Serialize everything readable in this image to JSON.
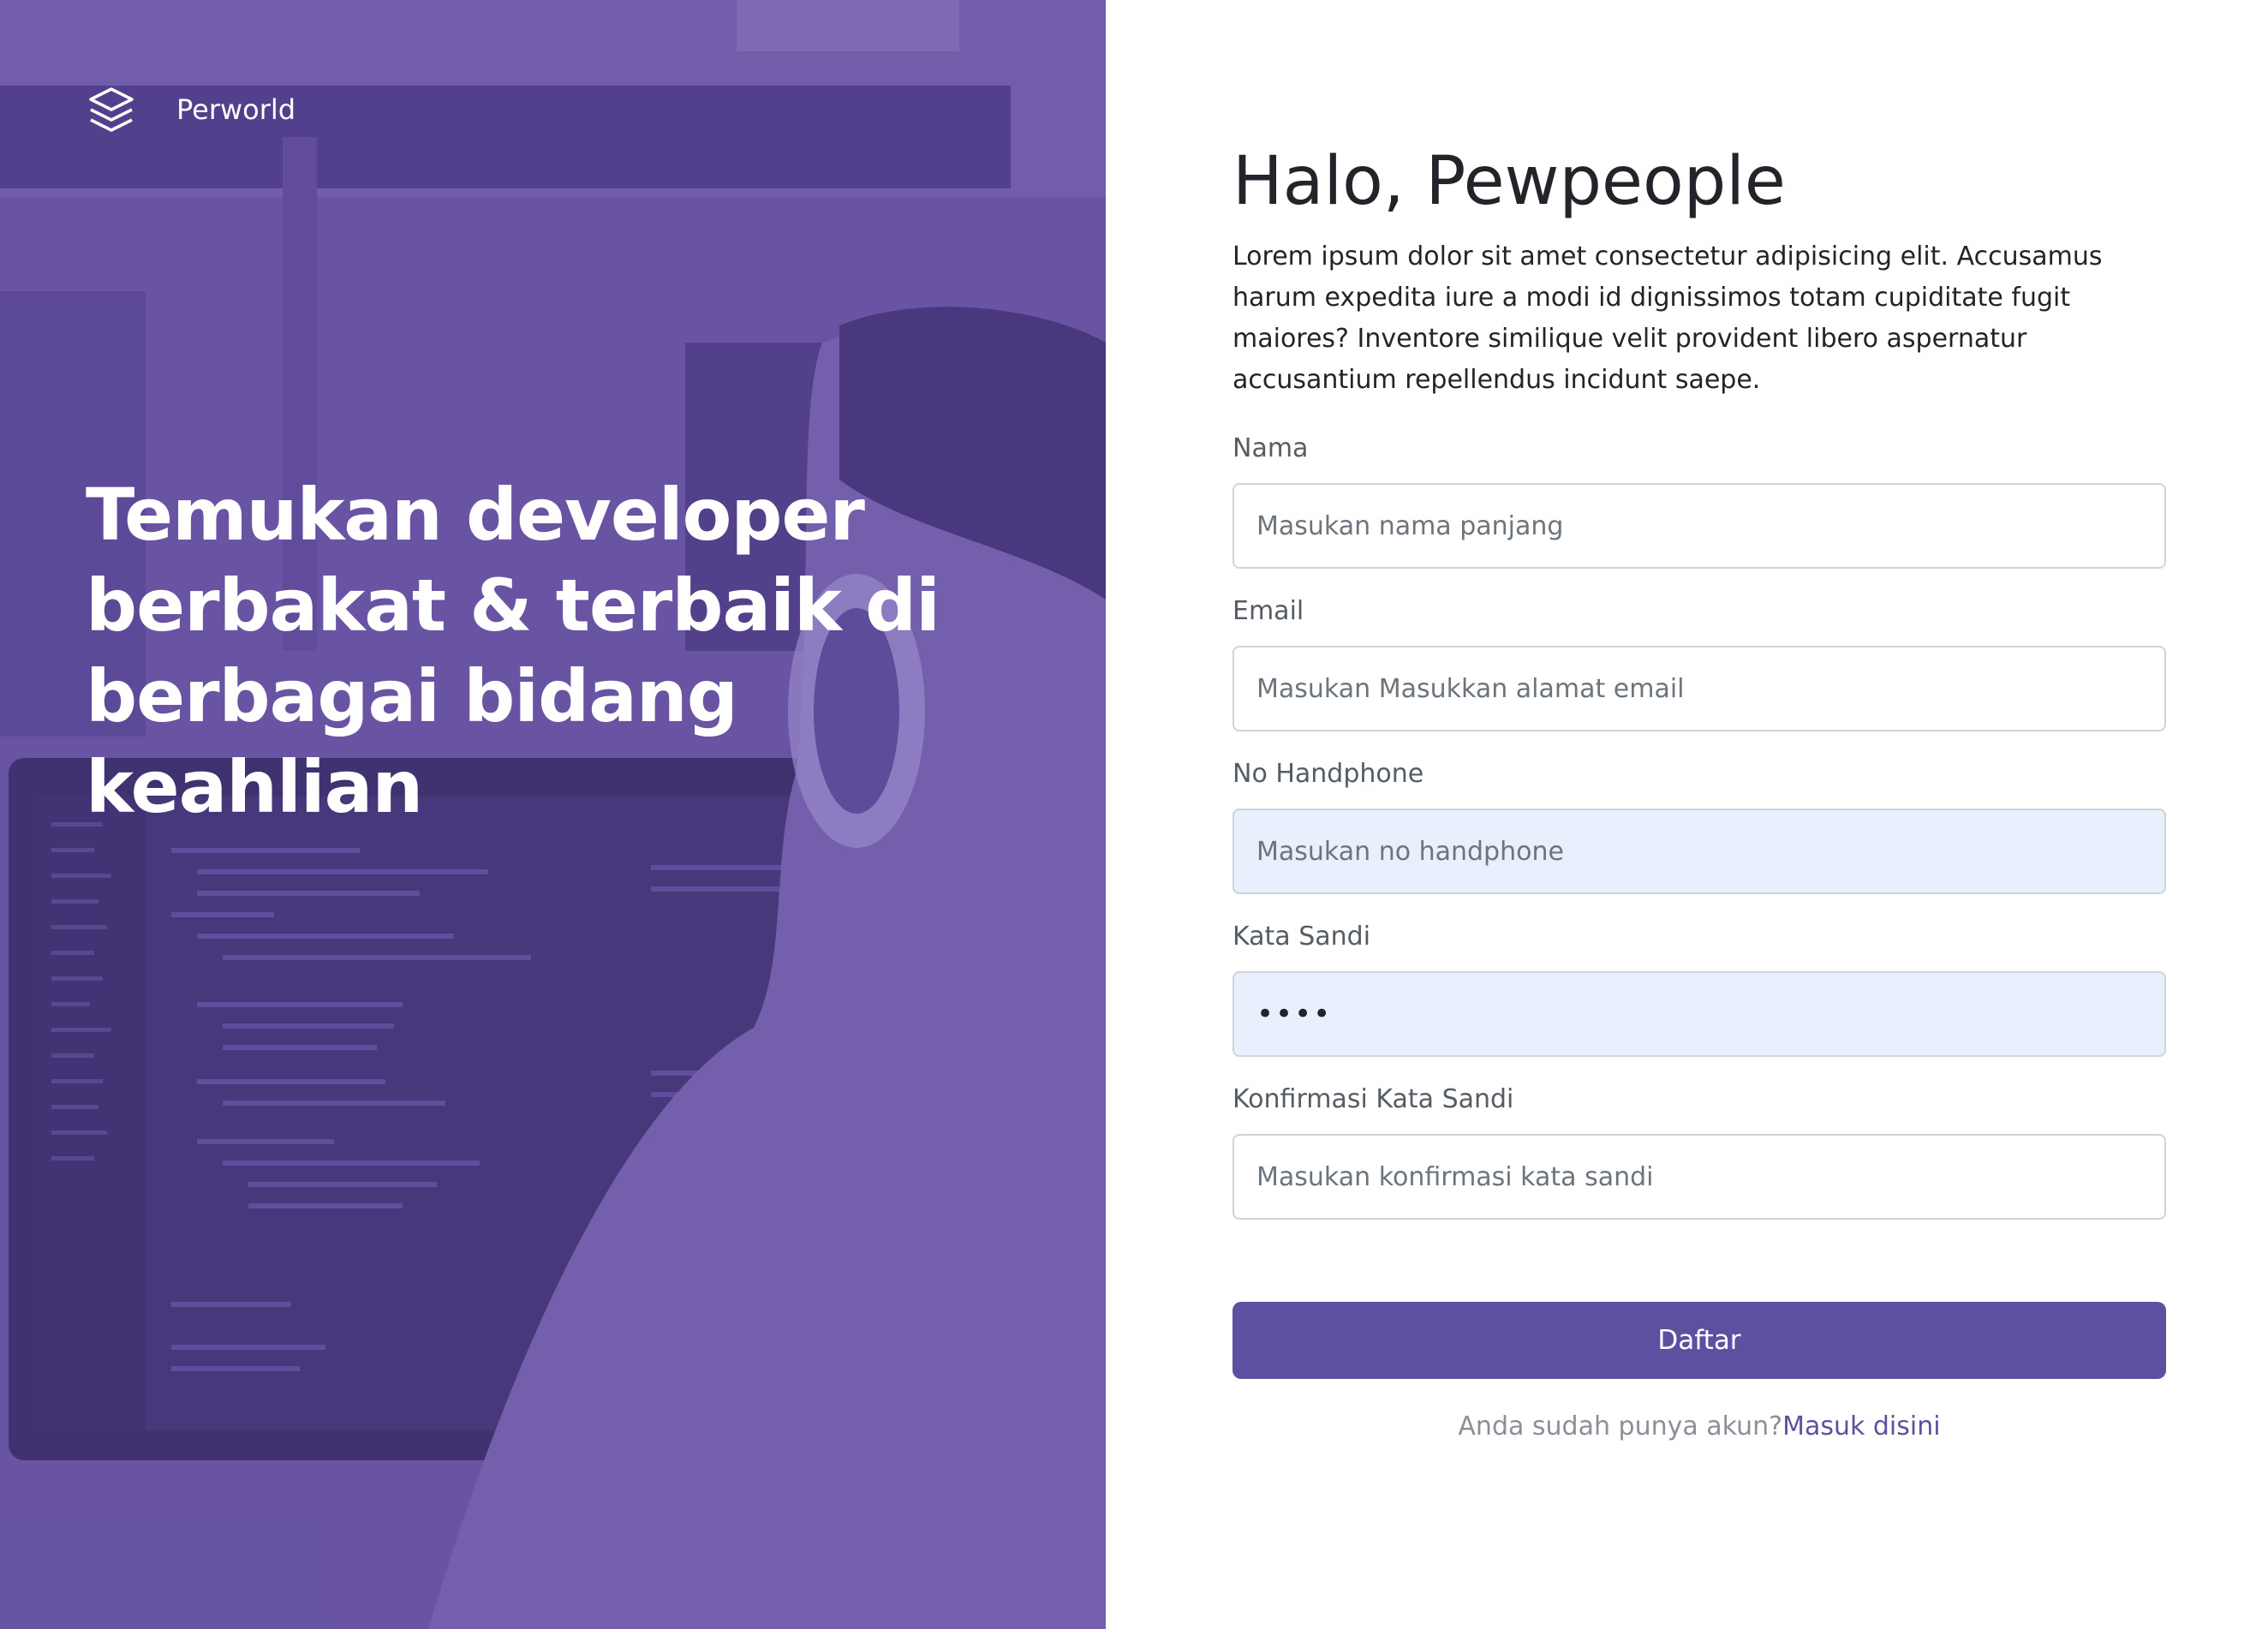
{
  "brand": {
    "name": "Perworld",
    "logo_icon": "layers-stack-icon"
  },
  "hero": {
    "headline_lines": [
      "Temukan developer",
      "berbakat & terbaik di",
      "berbagai bidang keahlian"
    ],
    "overlay_color": "#6b54a3"
  },
  "form": {
    "greeting": "Halo, Pewpeople",
    "intro": "Lorem ipsum dolor sit amet consectetur adipisicing elit. Accusamus harum expedita iure a modi id dignissimos totam cupiditate fugit maiores? Inventore similique velit provident libero aspernatur accusantium repellendus incidunt saepe.",
    "fields": {
      "name": {
        "label": "Nama",
        "placeholder": "Masukan nama panjang",
        "value": ""
      },
      "email": {
        "label": "Email",
        "placeholder": "Masukan Masukkan alamat email",
        "value": ""
      },
      "phone": {
        "label": "No Handphone",
        "placeholder": "Masukan no handphone",
        "value": ""
      },
      "password": {
        "label": "Kata Sandi",
        "placeholder": "",
        "value": "••••"
      },
      "confirm_password": {
        "label": "Konfirmasi Kata Sandi",
        "placeholder": "Masukan konfirmasi kata sandi",
        "value": ""
      }
    },
    "submit_label": "Daftar",
    "login_prompt": "Anda sudah punya akun?",
    "login_link": "Masuk disini"
  },
  "colors": {
    "accent": "#5e50a1",
    "autofill_bg": "#e8f0fe",
    "text": "#212529",
    "muted": "#8a8f98"
  }
}
